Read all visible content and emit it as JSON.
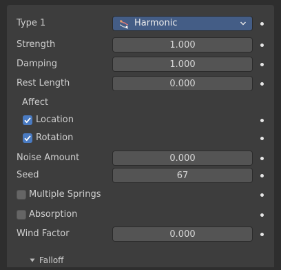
{
  "type": {
    "label": "Type 1",
    "value": "Harmonic",
    "icon": "harmonic-force-icon"
  },
  "strength": {
    "label": "Strength",
    "value": "1.000"
  },
  "damping": {
    "label": "Damping",
    "value": "1.000"
  },
  "rest_length": {
    "label": "Rest Length",
    "value": "0.000"
  },
  "affect": {
    "label": "Affect",
    "location": {
      "label": "Location",
      "checked": true
    },
    "rotation": {
      "label": "Rotation",
      "checked": true
    }
  },
  "noise_amount": {
    "label": "Noise Amount",
    "value": "0.000"
  },
  "seed": {
    "label": "Seed",
    "value": "67"
  },
  "multiple_springs": {
    "label": "Multiple Springs",
    "checked": false
  },
  "absorption": {
    "label": "Absorption",
    "checked": false
  },
  "wind_factor": {
    "label": "Wind Factor",
    "value": "0.000"
  },
  "falloff": {
    "label": "Falloff",
    "expanded": false
  },
  "colors": {
    "background": "#3d3d3d",
    "field": "#545454",
    "dropdown": "#445d86",
    "checkbox_on": "#4a7bc2"
  }
}
